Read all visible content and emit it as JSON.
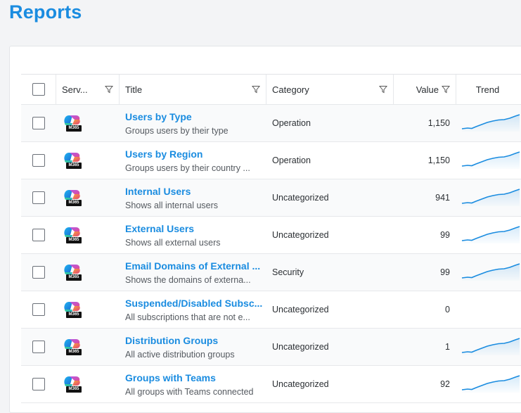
{
  "page": {
    "title": "Reports"
  },
  "table": {
    "headers": {
      "service": "Serv...",
      "title": "Title",
      "category": "Category",
      "value": "Value",
      "trend": "Trend"
    },
    "rows": [
      {
        "service_badge": "M365",
        "title": "Users by Type",
        "subtitle": "Groups users by their type",
        "category": "Operation",
        "value": "1,150",
        "trend": "up"
      },
      {
        "service_badge": "M365",
        "title": "Users by Region",
        "subtitle": "Groups users by their country ...",
        "category": "Operation",
        "value": "1,150",
        "trend": "up"
      },
      {
        "service_badge": "M365",
        "title": "Internal Users",
        "subtitle": "Shows all internal users",
        "category": "Uncategorized",
        "value": "941",
        "trend": "up"
      },
      {
        "service_badge": "M365",
        "title": "External Users",
        "subtitle": "Shows all external users",
        "category": "Uncategorized",
        "value": "99",
        "trend": "up"
      },
      {
        "service_badge": "M365",
        "title": "Email Domains of External ...",
        "subtitle": "Shows the domains of externa...",
        "category": "Security",
        "value": "99",
        "trend": "up"
      },
      {
        "service_badge": "M365",
        "title": "Suspended/Disabled Subsc...",
        "subtitle": "All subscriptions that are not e...",
        "category": "Uncategorized",
        "value": "0",
        "trend": "none"
      },
      {
        "service_badge": "M365",
        "title": "Distribution Groups",
        "subtitle": "All active distribution groups",
        "category": "Uncategorized",
        "value": "1",
        "trend": "up"
      },
      {
        "service_badge": "M365",
        "title": "Groups with Teams",
        "subtitle": "All groups with Teams connected",
        "category": "Uncategorized",
        "value": "92",
        "trend": "up"
      }
    ]
  },
  "colors": {
    "accent": "#1a8ce0",
    "sparkline": "#1a8ce0"
  }
}
